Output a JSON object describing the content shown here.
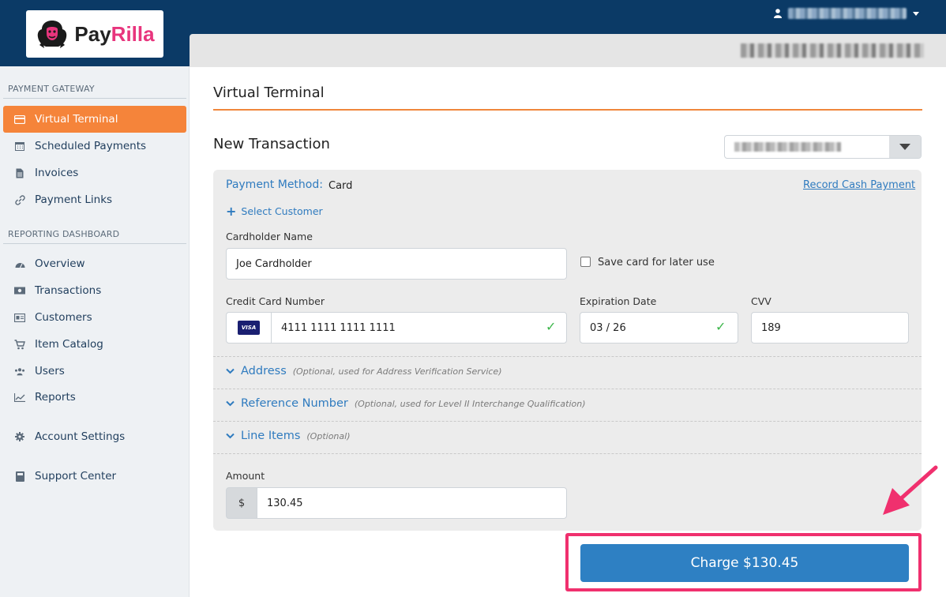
{
  "brand": {
    "logo_pay": "Pay",
    "logo_rilla": "Rilla"
  },
  "sidebar": {
    "sections": [
      {
        "title": "PAYMENT GATEWAY"
      },
      {
        "title": "REPORTING DASHBOARD"
      }
    ],
    "items": [
      {
        "label": "Virtual Terminal",
        "icon": "credit-card-icon",
        "active": true
      },
      {
        "label": "Scheduled Payments",
        "icon": "calendar-icon"
      },
      {
        "label": "Invoices",
        "icon": "document-icon"
      },
      {
        "label": "Payment Links",
        "icon": "link-icon"
      },
      {
        "label": "Overview",
        "icon": "dashboard-icon"
      },
      {
        "label": "Transactions",
        "icon": "money-icon"
      },
      {
        "label": "Customers",
        "icon": "id-card-icon"
      },
      {
        "label": "Item Catalog",
        "icon": "cart-icon"
      },
      {
        "label": "Users",
        "icon": "users-icon"
      },
      {
        "label": "Reports",
        "icon": "chart-icon"
      },
      {
        "label": "Account Settings",
        "icon": "gear-icon"
      },
      {
        "label": "Support Center",
        "icon": "book-icon"
      }
    ]
  },
  "page": {
    "title": "Virtual Terminal",
    "subtitle": "New Transaction"
  },
  "form": {
    "payment_method_label": "Payment Method:",
    "payment_method_value": "Card",
    "record_cash": "Record Cash Payment",
    "select_customer": "Select Customer",
    "cardholder_label": "Cardholder Name",
    "cardholder_value": "Joe Cardholder",
    "save_card_label": "Save card for later use",
    "card_number_label": "Credit Card Number",
    "card_number_value": "4111 1111 1111 1111",
    "card_brand": "VISA",
    "expiration_label": "Expiration Date",
    "expiration_value": "03 / 26",
    "cvv_label": "CVV",
    "cvv_value": "189",
    "address_title": "Address",
    "address_note": "(Optional, used for Address Verification Service)",
    "reference_title": "Reference Number",
    "reference_note": "(Optional, used for Level II Interchange Qualification)",
    "line_items_title": "Line Items",
    "line_items_note": "(Optional)",
    "amount_label": "Amount",
    "currency_symbol": "$",
    "amount_value": "130.45",
    "charge_button": "Charge $130.45"
  },
  "colors": {
    "topbar": "#0b3a66",
    "accent_orange": "#f5843a",
    "link_blue": "#2f7bbf",
    "button_blue": "#2e80c3",
    "highlight_pink": "#f0306e"
  }
}
